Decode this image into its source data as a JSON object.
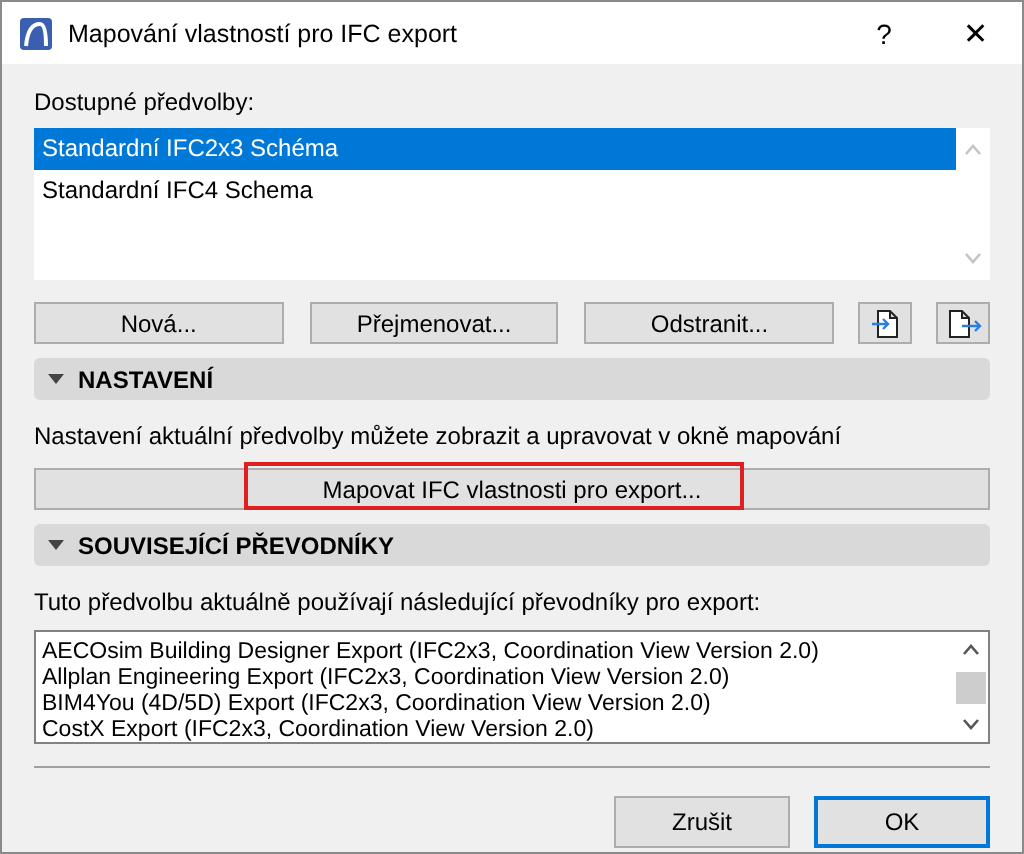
{
  "window": {
    "title": "Mapování vlastností pro IFC export"
  },
  "title_buttons": [
    "?",
    "✕"
  ],
  "presets": {
    "label": "Dostupné předvolby:",
    "items": [
      {
        "label": "Standardní IFC2x3 Schéma",
        "selected": true
      },
      {
        "label": "Standardní IFC4 Schema",
        "selected": false
      }
    ]
  },
  "preset_buttons": [
    "Nová...",
    "Přejmenovat...",
    "Odstranit..."
  ],
  "sections": [
    {
      "title": "NASTAVENÍ",
      "expanded": true,
      "text": "Nastavení aktuální předvolby můžete zobrazit a upravovat v okně mapování",
      "button": {
        "label": "Mapovat IFC vlastnosti pro export...",
        "highlighted": true
      }
    },
    {
      "title": "SOUVISEJÍCÍ PŘEVODNÍKY",
      "expanded": true,
      "text": "Tuto předvolbu aktuálně používají následující převodníky pro export:",
      "items": [
        "AECOsim Building Designer Export (IFC2x3, Coordination View Version 2.0)",
        "Allplan Engineering Export (IFC2x3, Coordination View Version 2.0)",
        "BIM4You (4D/5D) Export (IFC2x3, Coordination View Version 2.0)",
        "CostX Export (IFC2x3, Coordination View Version 2.0)"
      ]
    }
  ],
  "dialog_buttons": [
    {
      "label": "Zrušit",
      "default": false
    },
    {
      "label": "OK",
      "default": true
    }
  ]
}
